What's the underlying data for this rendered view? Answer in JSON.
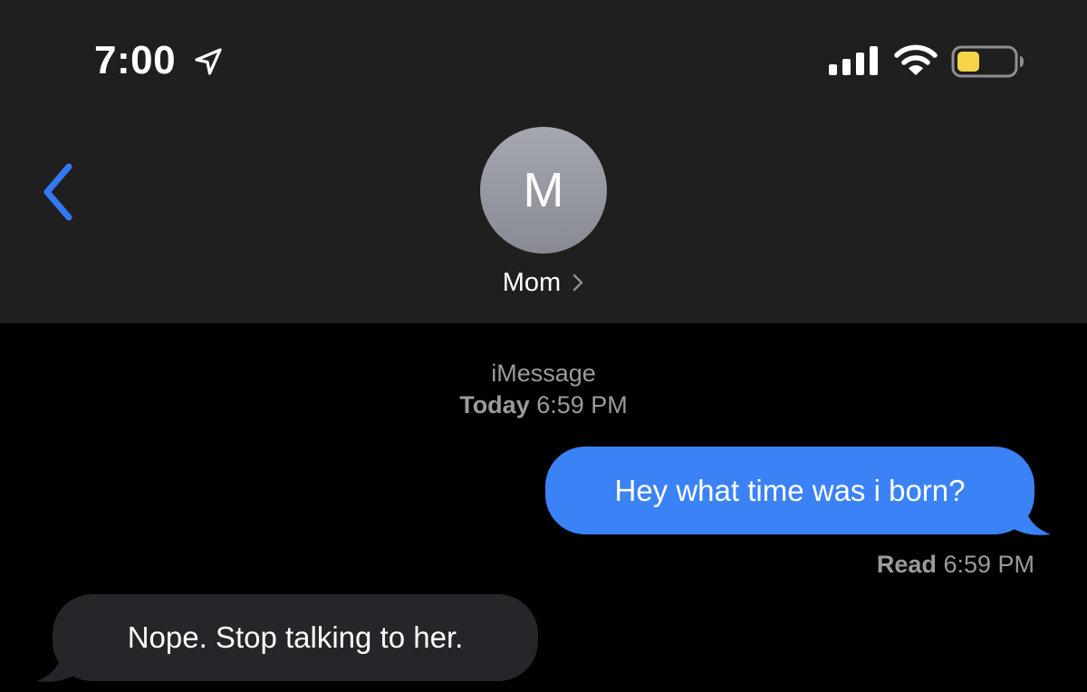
{
  "status_bar": {
    "time": "7:00",
    "location_icon": "location-arrow-icon",
    "signal_icon": "cellular-signal-icon",
    "wifi_icon": "wifi-icon",
    "battery_icon": "battery-icon",
    "battery_level": 0.4,
    "battery_color": "#f5d547"
  },
  "header": {
    "back_icon": "chevron-left-icon",
    "avatar_initial": "M",
    "contact_name": "Mom",
    "contact_chevron_icon": "chevron-right-icon",
    "accent_color": "#3478f6"
  },
  "conversation": {
    "service": "iMessage",
    "timestamp_day": "Today",
    "timestamp_time": "6:59 PM",
    "messages": [
      {
        "direction": "sent",
        "text": "Hey what time was i born?",
        "bubble_color": "#3b82f6"
      },
      {
        "direction": "received",
        "text": "Nope. Stop talking to her.",
        "bubble_color": "#26262a"
      }
    ],
    "read_receipt": {
      "label": "Read",
      "time": "6:59 PM"
    }
  }
}
